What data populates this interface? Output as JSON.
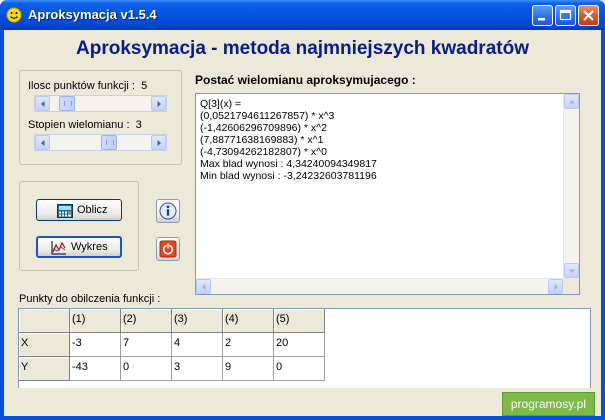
{
  "window": {
    "title": "Aproksymacja v1.5.4"
  },
  "header": {
    "title": "Aproksymacja - metoda najmniejszych kwadratów"
  },
  "settings": {
    "points_label": "Ilosc punktów funkcji :",
    "points_value": "5",
    "points_slider_fraction": 0.1,
    "degree_label": "Stopien wielomianu :",
    "degree_value": "3",
    "degree_slider_fraction": 0.6
  },
  "actions": {
    "compute_label": "Oblicz",
    "chart_label": "Wykres"
  },
  "result": {
    "heading": "Postać wielomianu aproksymujacego :",
    "lines": [
      "Q[3](x) =",
      "(0,0521794611267857) * x^3",
      "(-1,42606296709896) * x^2",
      "(7,88771638169883) * x^1",
      "(-4,73094262182807) * x^0",
      "Max blad wynosi : 4,34240094349817",
      "Min blad wynosi : -3,24232603781196"
    ]
  },
  "points": {
    "label": "Punkty do obilczenia funkcji :",
    "columns": [
      "",
      "(1)",
      "(2)",
      "(3)",
      "(4)",
      "(5)"
    ],
    "rows": [
      {
        "label": "X",
        "values": [
          "-3",
          "7",
          "4",
          "2",
          "20"
        ]
      },
      {
        "label": "Y",
        "values": [
          "-43",
          "0",
          "3",
          "9",
          "0"
        ]
      }
    ]
  },
  "footer": {
    "brand": "programosy.pl"
  }
}
